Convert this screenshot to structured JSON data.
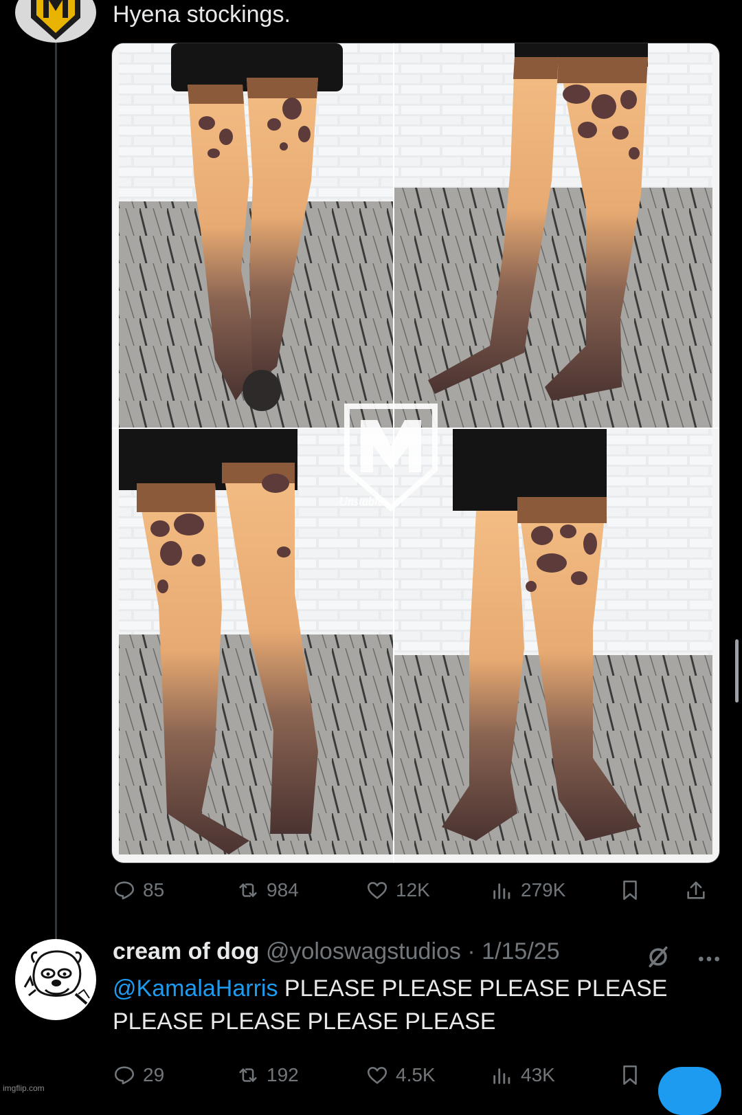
{
  "tweet1": {
    "text": "Hyena stockings.",
    "media": {
      "watermark_text": "Unstable"
    },
    "actions": {
      "replies": "85",
      "reposts": "984",
      "likes": "12K",
      "views": "279K"
    }
  },
  "reply": {
    "display_name": "cream of dog",
    "handle": "@yoloswagstudios",
    "separator": "·",
    "date": "1/15/25",
    "mention": "@KamalaHarris",
    "body": " PLEASE PLEASE PLEASE PLEASE PLEASE PLEASE PLEASE PLEASE",
    "actions": {
      "replies": "29",
      "reposts": "192",
      "likes": "4.5K",
      "views": "43K"
    }
  },
  "footer": {
    "watermark": "imgflip.com"
  },
  "icons": [
    "reply-icon",
    "repost-icon",
    "like-icon",
    "views-icon",
    "bookmark-icon",
    "share-icon",
    "mute-icon",
    "more-icon"
  ],
  "colors": {
    "background": "#000000",
    "text": "#e7e9ea",
    "muted": "#71767b",
    "accent": "#1d9bf0"
  }
}
